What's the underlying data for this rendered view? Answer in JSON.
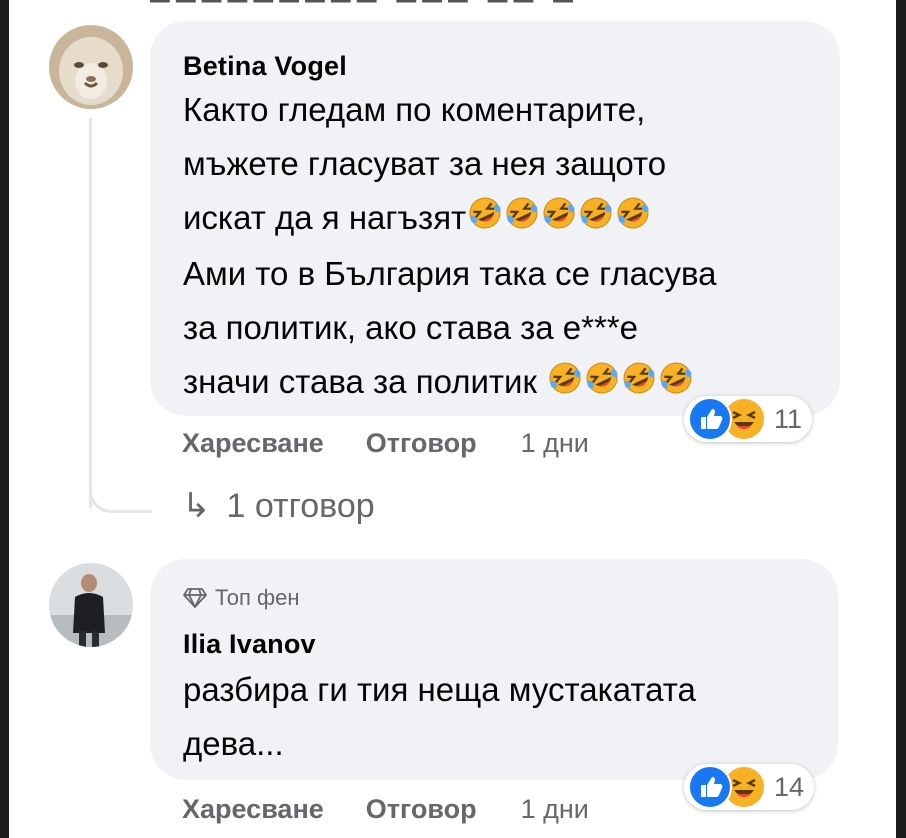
{
  "comments": [
    {
      "author": "Betina Vogel",
      "lines": [
        "Както гледам по коментарите,",
        "мъжете гласуват за нея защото",
        "искат да я нагъзят",
        "Ами то в България така се гласува",
        "за политик, ако става за е***е",
        "значи става за политик"
      ],
      "reaction_count": "11",
      "like_label": "Харесване",
      "reply_label": "Отговор",
      "time": "1 дни",
      "replies_label": "1 отговор"
    },
    {
      "badge": "Топ фен",
      "author": "Ilia Ivanov",
      "lines": [
        "разбира ги тия неща мустакатата",
        "дева..."
      ],
      "reaction_count": "14",
      "like_label": "Харесване",
      "reply_label": "Отговор",
      "time": "1 дни"
    }
  ],
  "icons": {
    "reaction_like": "like-icon",
    "reaction_haha": "haha-icon",
    "emoji": "rolling-on-floor-laughing-emoji",
    "badge": "diamond-icon",
    "reply_arrow": "reply-arrow-icon"
  },
  "colors": {
    "bubble": "#f0f2f5",
    "secondary_text": "#65676b",
    "like_blue": "#1877f2",
    "haha_yellow": "#f7b125"
  }
}
